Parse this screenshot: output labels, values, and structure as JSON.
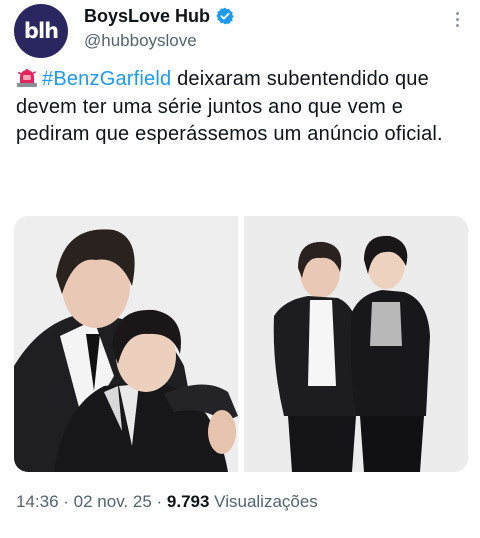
{
  "author": {
    "display_name": "BoysLove Hub",
    "handle": "@hubboyslove",
    "avatar_text": "blh",
    "verified": true
  },
  "tweet": {
    "emoji_icon": "police-light-icon",
    "hashtag": "#BenzGarfield",
    "text_after_hashtag": " deixaram subentendido que devem ter uma série juntos ano que vem e pediram que esperássemos um anúncio oficial."
  },
  "meta": {
    "time": "14:36",
    "separator": " · ",
    "date": "02 nov. 25",
    "views_count": "9.793",
    "views_label": " Visualizações"
  },
  "colors": {
    "link": "#1d9bf0",
    "avatar_bg": "#2a2760",
    "muted": "#536471"
  }
}
